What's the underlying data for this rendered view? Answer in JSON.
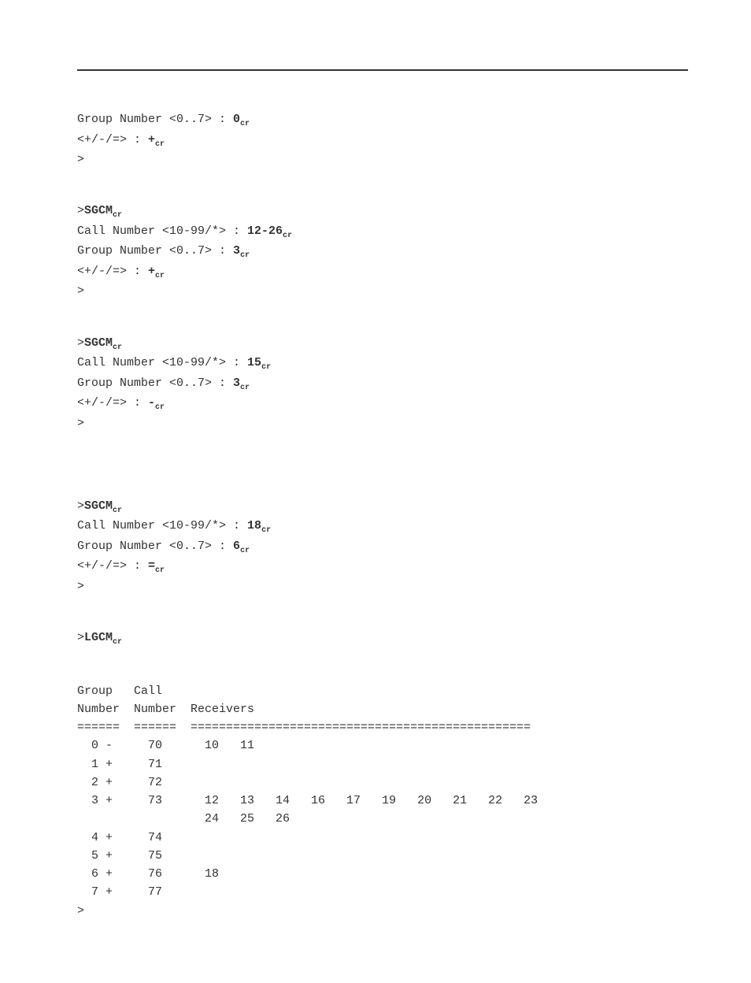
{
  "cr": "cr",
  "blocks": {
    "b1": {
      "l1_prompt": "Group Number <0..7> : ",
      "l1_input": "0",
      "l2_prompt": "<+/-/=> : ",
      "l2_input": "+",
      "l3": ">"
    },
    "b2": {
      "l0_prompt": ">",
      "l0_cmd": "SGCM",
      "l1_prompt": "Call Number <10-99/*> : ",
      "l1_input": "12-26",
      "l2_prompt": "Group Number <0..7> : ",
      "l2_input": "3",
      "l3_prompt": "<+/-/=> : ",
      "l3_input": "+",
      "l4": ">"
    },
    "b3": {
      "l0_prompt": ">",
      "l0_cmd": "SGCM",
      "l1_prompt": "Call Number <10-99/*> : ",
      "l1_input": "15",
      "l2_prompt": "Group Number <0..7> : ",
      "l2_input": "3",
      "l3_prompt": "<+/-/=> : ",
      "l3_input": "-",
      "l4": ">"
    },
    "b4": {
      "l0_prompt": ">",
      "l0_cmd": "SGCM",
      "l1_prompt": "Call Number <10-99/*> : ",
      "l1_input": "18",
      "l2_prompt": "Group Number <0..7> : ",
      "l2_input": "6",
      "l3_prompt": "<+/-/=> : ",
      "l3_input": "=",
      "l4": ">"
    },
    "b5": {
      "l0_prompt": ">",
      "l0_cmd": "LGCM"
    }
  },
  "table": {
    "h1": "Group   Call",
    "h2": "Number  Number  Receivers",
    "sep": "======  ======  ================================================",
    "rows": [
      "  0 -     70      10   11",
      "  1 +     71",
      "  2 +     72",
      "  3 +     73      12   13   14   16   17   19   20   21   22   23",
      "                  24   25   26",
      "  4 +     74",
      "  5 +     75",
      "  6 +     76      18",
      "  7 +     77"
    ],
    "end": ">"
  }
}
